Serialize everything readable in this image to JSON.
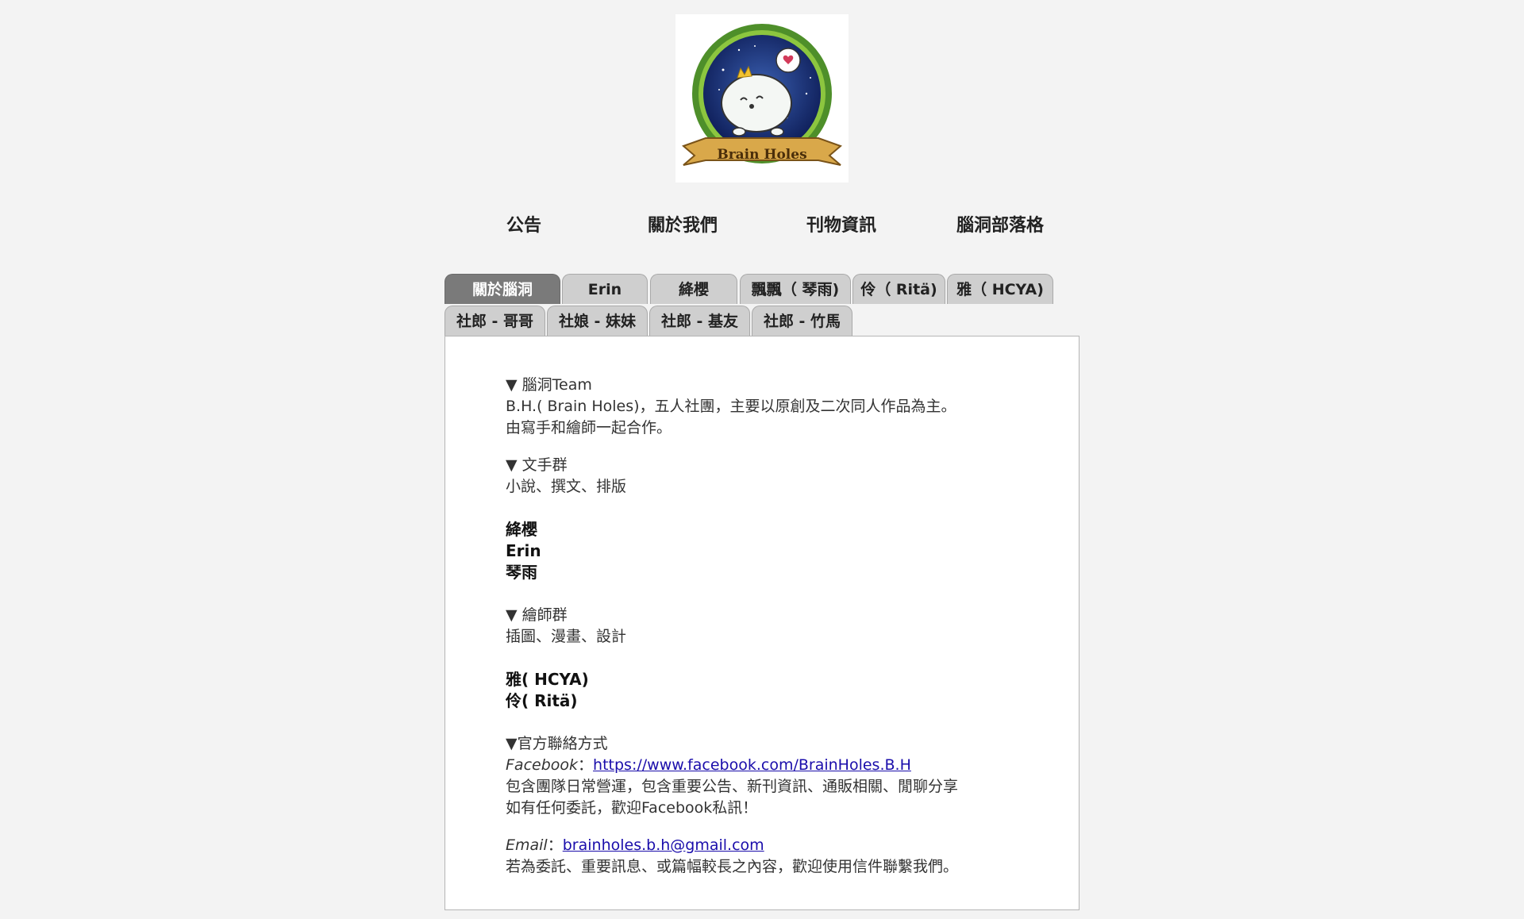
{
  "logo": {
    "icon": "brain-holes-logo-icon",
    "banner_text": "Brain Holes"
  },
  "nav": {
    "items": [
      {
        "label": "公告"
      },
      {
        "label": "關於我們"
      },
      {
        "label": "刊物資訊"
      },
      {
        "label": "腦洞部落格"
      }
    ]
  },
  "tabs": {
    "row1": [
      {
        "label": "關於腦洞",
        "active": true
      },
      {
        "label": "Erin"
      },
      {
        "label": "絳櫻"
      },
      {
        "label": "飄飄（ 琴雨)"
      },
      {
        "label": "伶（ Ritä)"
      },
      {
        "label": "雅（ HCYA)"
      }
    ],
    "row2": [
      {
        "label": "社郎 - 哥哥"
      },
      {
        "label": "社娘 - 妹妹"
      },
      {
        "label": "社郎 - 基友"
      },
      {
        "label": "社郎 - 竹馬"
      }
    ]
  },
  "content": {
    "team_heading": "▼ 腦洞Team",
    "team_line1": "B.H.( Brain Holes)，五人社團，主要以原創及二次同人作品為主。",
    "team_line2": "由寫手和繪師一起合作。",
    "writers_heading": "▼ 文手群",
    "writers_desc": "小說、撰文、排版",
    "writers": [
      "絳櫻",
      "Erin",
      "琴雨"
    ],
    "artists_heading": "▼ 繪師群",
    "artists_desc": "插圖、漫畫、設計",
    "artists": [
      "雅( HCYA)",
      "伶( Ritä)"
    ],
    "contact_heading": "▼官方聯絡方式",
    "facebook_label": "Facebook",
    "facebook_sep": "：",
    "facebook_url": "https://www.facebook.com/BrainHoles.B.H",
    "facebook_line1": "包含團隊日常營運，包含重要公告、新刊資訊、通販相關、閒聊分享",
    "facebook_line2": "如有任何委託，歡迎Facebook私訊！",
    "email_label": "Email",
    "email_sep": "：",
    "email_address": "brainholes.b.h@gmail.com",
    "email_line": "若為委託、重要訊息、或篇幅較長之內容，歡迎使用信件聯繫我們。"
  },
  "colors": {
    "page_bg": "#f3f3f3",
    "tab_bg": "#cfcfcf",
    "tab_active_bg": "#7a7a7a",
    "link": "#1a0dab"
  }
}
